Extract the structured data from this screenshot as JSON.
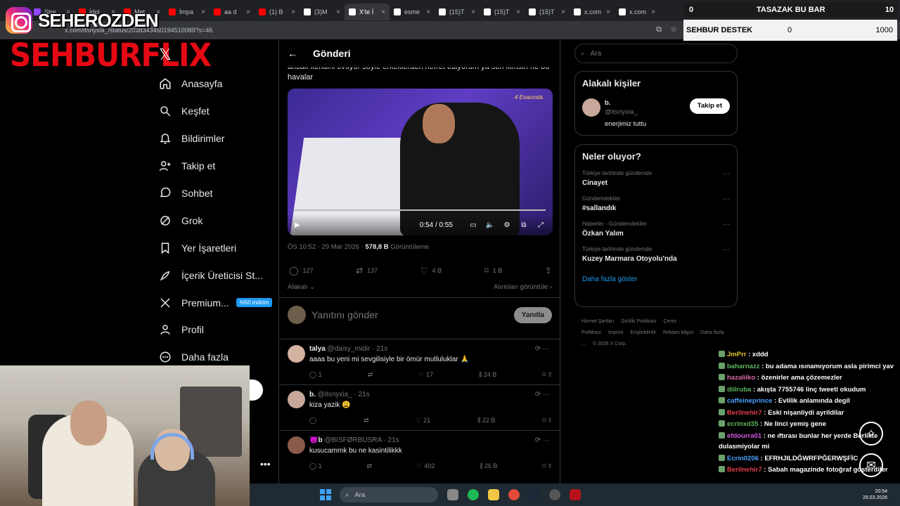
{
  "browser": {
    "tabs": [
      {
        "label": "Stre",
        "color": "#9146ff"
      },
      {
        "label": "İdol",
        "color": "#ff0000"
      },
      {
        "label": "Met",
        "color": "#ff0000"
      },
      {
        "label": "İmpa",
        "color": "#ff0000"
      },
      {
        "label": "aa d",
        "color": "#ff0000"
      },
      {
        "label": "(1) B",
        "color": "#ff0000"
      },
      {
        "label": "(3)M",
        "color": "#ffffff"
      },
      {
        "label": "X'te İ",
        "color": "#ffffff"
      },
      {
        "label": "esme",
        "color": "#ffffff"
      },
      {
        "label": "(15)T",
        "color": "#ffffff"
      },
      {
        "label": "(15)T",
        "color": "#ffffff"
      },
      {
        "label": "(15)T",
        "color": "#ffffff"
      },
      {
        "label": "x.com",
        "color": "#ffffff"
      },
      {
        "label": "x.com",
        "color": "#ffffff"
      }
    ],
    "url": "x.com/itsnyxia_/status/2038343450194510089?s=46"
  },
  "overlay": {
    "instagram_name": "SEHEROZDEN",
    "brand": "SEHBURFLIX",
    "donation_title": "TASAZAK BU BAR",
    "donation_left": "0",
    "donation_right": "10",
    "goal_label": "SEHBUR DESTEK",
    "goal_current": "0",
    "goal_target": "1000"
  },
  "nav": {
    "items": [
      {
        "label": "Anasayfa",
        "icon": "home-icon"
      },
      {
        "label": "Keşfet",
        "icon": "search-icon"
      },
      {
        "label": "Bildirimler",
        "icon": "bell-icon"
      },
      {
        "label": "Takip et",
        "icon": "add-user-icon"
      },
      {
        "label": "Sohbet",
        "icon": "chat-icon"
      },
      {
        "label": "Grok",
        "icon": "grok-icon"
      },
      {
        "label": "Yer İşaretleri",
        "icon": "bookmark-icon"
      },
      {
        "label": "İçerik Üreticisi St...",
        "icon": "rocket-icon"
      },
      {
        "label": "Premium...",
        "icon": "x-icon"
      },
      {
        "label": "Profil",
        "icon": "profile-icon"
      },
      {
        "label": "Daha fazla",
        "icon": "more-icon"
      }
    ],
    "premium_badge": "%50 indirim"
  },
  "post": {
    "header": "Gönderi",
    "text": "ancak kendini övüyor söyle erkeklerden nefret ediyorum ya sen kimsin ne bu havalar",
    "video_watermark": "4 Esasında",
    "video_time": "0:54 / 0:55",
    "timestamp": "ÖS 10:52 · 29 Mar 2026 ·",
    "views": "578,8 B",
    "views_label": "Görüntüleme",
    "replies": "127",
    "reposts": "137",
    "likes": "4 B",
    "bookmarks": "1 B",
    "sort_label": "Alakalı",
    "quotes_label": "Alıntıları görüntüle",
    "reply_placeholder": "Yanıtını gönder",
    "reply_button": "Yanıtla"
  },
  "replies": [
    {
      "name": "talya",
      "handle": "@daisy_midir",
      "time": "· 21s",
      "text": "aaaa bu yeni mi sevgilisiyle bir ömür mutluluklar 🙏",
      "replies": "1",
      "reposts": "",
      "likes": "17",
      "views": "24 B",
      "color": "#d4b2a0"
    },
    {
      "name": "b.",
      "handle": "@itsnyxia_",
      "time": "· 21s",
      "text": "kiza yazik 😩",
      "replies": "",
      "reposts": "",
      "likes": "21",
      "views": "22 B",
      "color": "#c8a89a"
    },
    {
      "name": "😈b",
      "handle": "@BISFØRBUSRA",
      "time": "· 21s",
      "text": "kusucammk bu ne kasintilikkk",
      "replies": "1",
      "reposts": "",
      "likes": "402",
      "views": "26 B",
      "color": "#8a5a4a"
    }
  ],
  "sidebar": {
    "search_placeholder": "Ara",
    "who_title": "Alakalı kişiler",
    "who_name": "b.",
    "who_handle": "@itsnyxia_",
    "who_bio": "enerjimiz tuttu",
    "follow_label": "Takip et",
    "trends_title": "Neler oluyor?",
    "trends": [
      {
        "context": "Türkiye tarihinde gündemde",
        "name": "Cinayet"
      },
      {
        "context": "Gündemdekiler",
        "name": "#sallandık"
      },
      {
        "context": "Haberler · Gündemdekiler",
        "name": "Özkan Yalım"
      },
      {
        "context": "Türkiye tarihinde gündemde",
        "name": "Kuzey Marmara Otoyolu'nda"
      }
    ],
    "show_more": "Daha fazla göster",
    "footer": [
      "Hizmet Şartları",
      "Gizlilik Politikası",
      "Çerez Politikası",
      "Imprint",
      "Erişilebilirlik",
      "Reklam bilgisi",
      "Daha fazla ...",
      "© 2026 X Corp."
    ]
  },
  "chat": [
    {
      "user": "JmPrr",
      "color": "#e6c229",
      "msg": "xddd"
    },
    {
      "user": "baharnazz",
      "color": "#5fb85f",
      "msg": "bu adama ısınamıyorum asla pirimci yav"
    },
    {
      "user": "hazaliiko",
      "color": "#d86aa8",
      "msg": "özenirler ama çözemezler"
    },
    {
      "user": "diilruba",
      "color": "#5fb85f",
      "msg": "akışta 7755746 linç tweeti okudum"
    },
    {
      "user": "caffeineprince",
      "color": "#4aa3ff",
      "msg": "Evlilik anlamında degil"
    },
    {
      "user": "Berilnehir7",
      "color": "#e0404a",
      "msg": "Eski nişanliydi ayrildilar"
    },
    {
      "user": "ecrinxd35",
      "color": "#5fb85f",
      "msg": "Ne linci yemiş gene"
    },
    {
      "user": "efdourra01",
      "color": "#d05ae0",
      "msg": "ne ıftırası bunlar her yerde Berlikte dulasmiyolar mi"
    },
    {
      "user": "Ecrin0206",
      "color": "#4aa3ff",
      "msg": "EFRHJILDĞWRFPĞERWŞFİC"
    },
    {
      "user": "Berilnehir7",
      "color": "#e0404a",
      "msg": "Sabah magazinde fotoğraf gösterdiler"
    }
  ],
  "taskbar": {
    "search": "Ara",
    "time": "20:54",
    "date": "29.03.2026"
  }
}
